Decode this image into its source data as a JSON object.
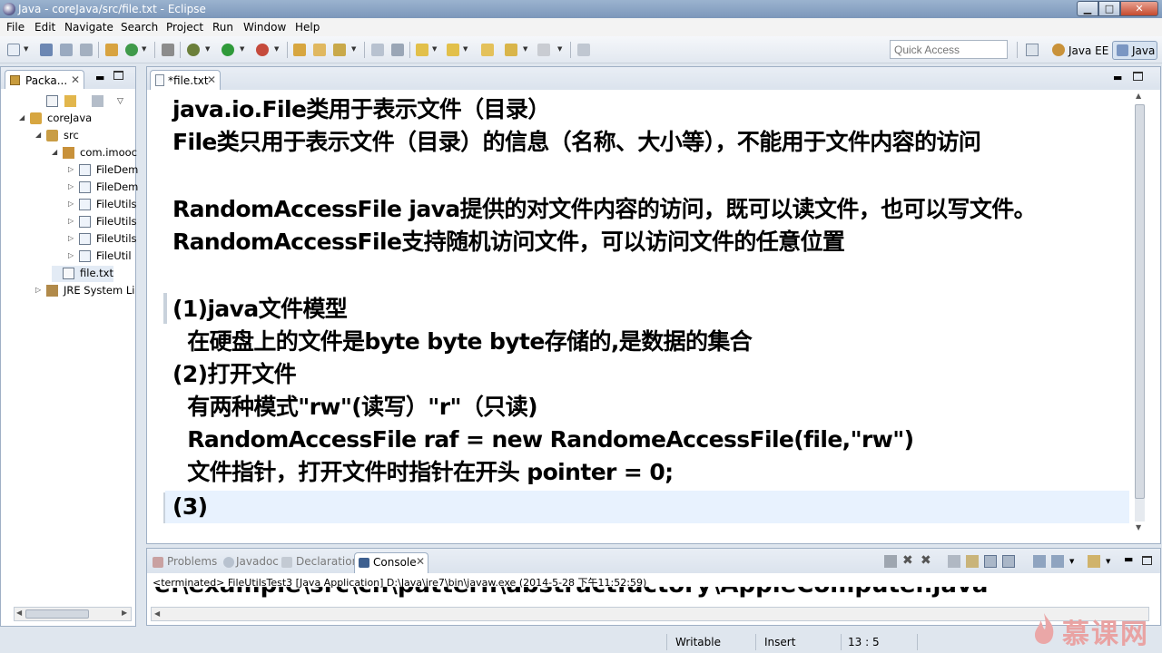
{
  "window": {
    "title": "Java - coreJava/src/file.txt - Eclipse",
    "minimize": "▁",
    "maximize": "□",
    "close": "✕"
  },
  "menu": [
    "File",
    "Edit",
    "Navigate",
    "Search",
    "Project",
    "Run",
    "Window",
    "Help"
  ],
  "toolbar": {
    "quick_access_placeholder": "Quick Access",
    "perspectives": [
      "Java EE",
      "Java"
    ]
  },
  "package_explorer": {
    "tab_label": "Packa...",
    "tab_close": "✕",
    "tree": [
      {
        "label": "coreJava",
        "level": 0,
        "icon": "project-icon"
      },
      {
        "label": "src",
        "level": 1,
        "icon": "source-folder-icon"
      },
      {
        "label": "com.imooc",
        "level": 2,
        "icon": "package-icon"
      },
      {
        "label": "FileDem",
        "level": 3,
        "icon": "java-file-icon"
      },
      {
        "label": "FileDem",
        "level": 3,
        "icon": "java-file-icon"
      },
      {
        "label": "FileUtils",
        "level": 3,
        "icon": "java-file-icon"
      },
      {
        "label": "FileUtils",
        "level": 3,
        "icon": "java-file-icon"
      },
      {
        "label": "FileUtils",
        "level": 3,
        "icon": "java-file-icon"
      },
      {
        "label": "FileUtil",
        "level": 3,
        "icon": "java-file-icon"
      },
      {
        "label": "file.txt",
        "level": 3,
        "icon": "text-file-icon"
      },
      {
        "label": "JRE System Li",
        "level": 1,
        "icon": "library-icon"
      }
    ]
  },
  "editor": {
    "tab_label": "*file.txt",
    "tab_close": "✕",
    "lines": [
      "java.io.File类用于表示文件（目录）",
      "File类只用于表示文件（目录）的信息（名称、大小等），不能用于文件内容的访问",
      "",
      "RandomAccessFile java提供的对文件内容的访问，既可以读文件，也可以写文件。",
      "RandomAccessFile支持随机访问文件，可以访问文件的任意位置",
      "",
      "(1)java文件模型",
      "  在硬盘上的文件是byte byte byte存储的,是数据的集合",
      "(2)打开文件",
      "  有两种模式\"rw\"(读写）\"r\"（只读)",
      "  RandomAccessFile raf = new RandomeAccessFile(file,\"rw\")",
      "  文件指针，打开文件时指针在开头 pointer = 0;",
      "(3)"
    ]
  },
  "console": {
    "tabs": [
      "Problems",
      "Javadoc",
      "Declaration",
      "Console"
    ],
    "active_tab": "Console",
    "active_close": "✕",
    "status": "<terminated> FileUtilsTest3 [Java Application] D:\\Java\\jre7\\bin\\javaw.exe (2014-5-28 下午11:52:59)",
    "output_line": "e:\\example\\src\\cn\\pattern\\abstractfactory\\AppleComputer.java"
  },
  "status_bar": {
    "writable": "Writable",
    "insert_mode": "Insert",
    "cursor_position": "13 : 5"
  },
  "watermark": {
    "text": "慕课网"
  },
  "colors": {
    "title_bar": "#7c97ba",
    "current_line": "#e8f2fe",
    "watermark": "#e9a3a3"
  }
}
